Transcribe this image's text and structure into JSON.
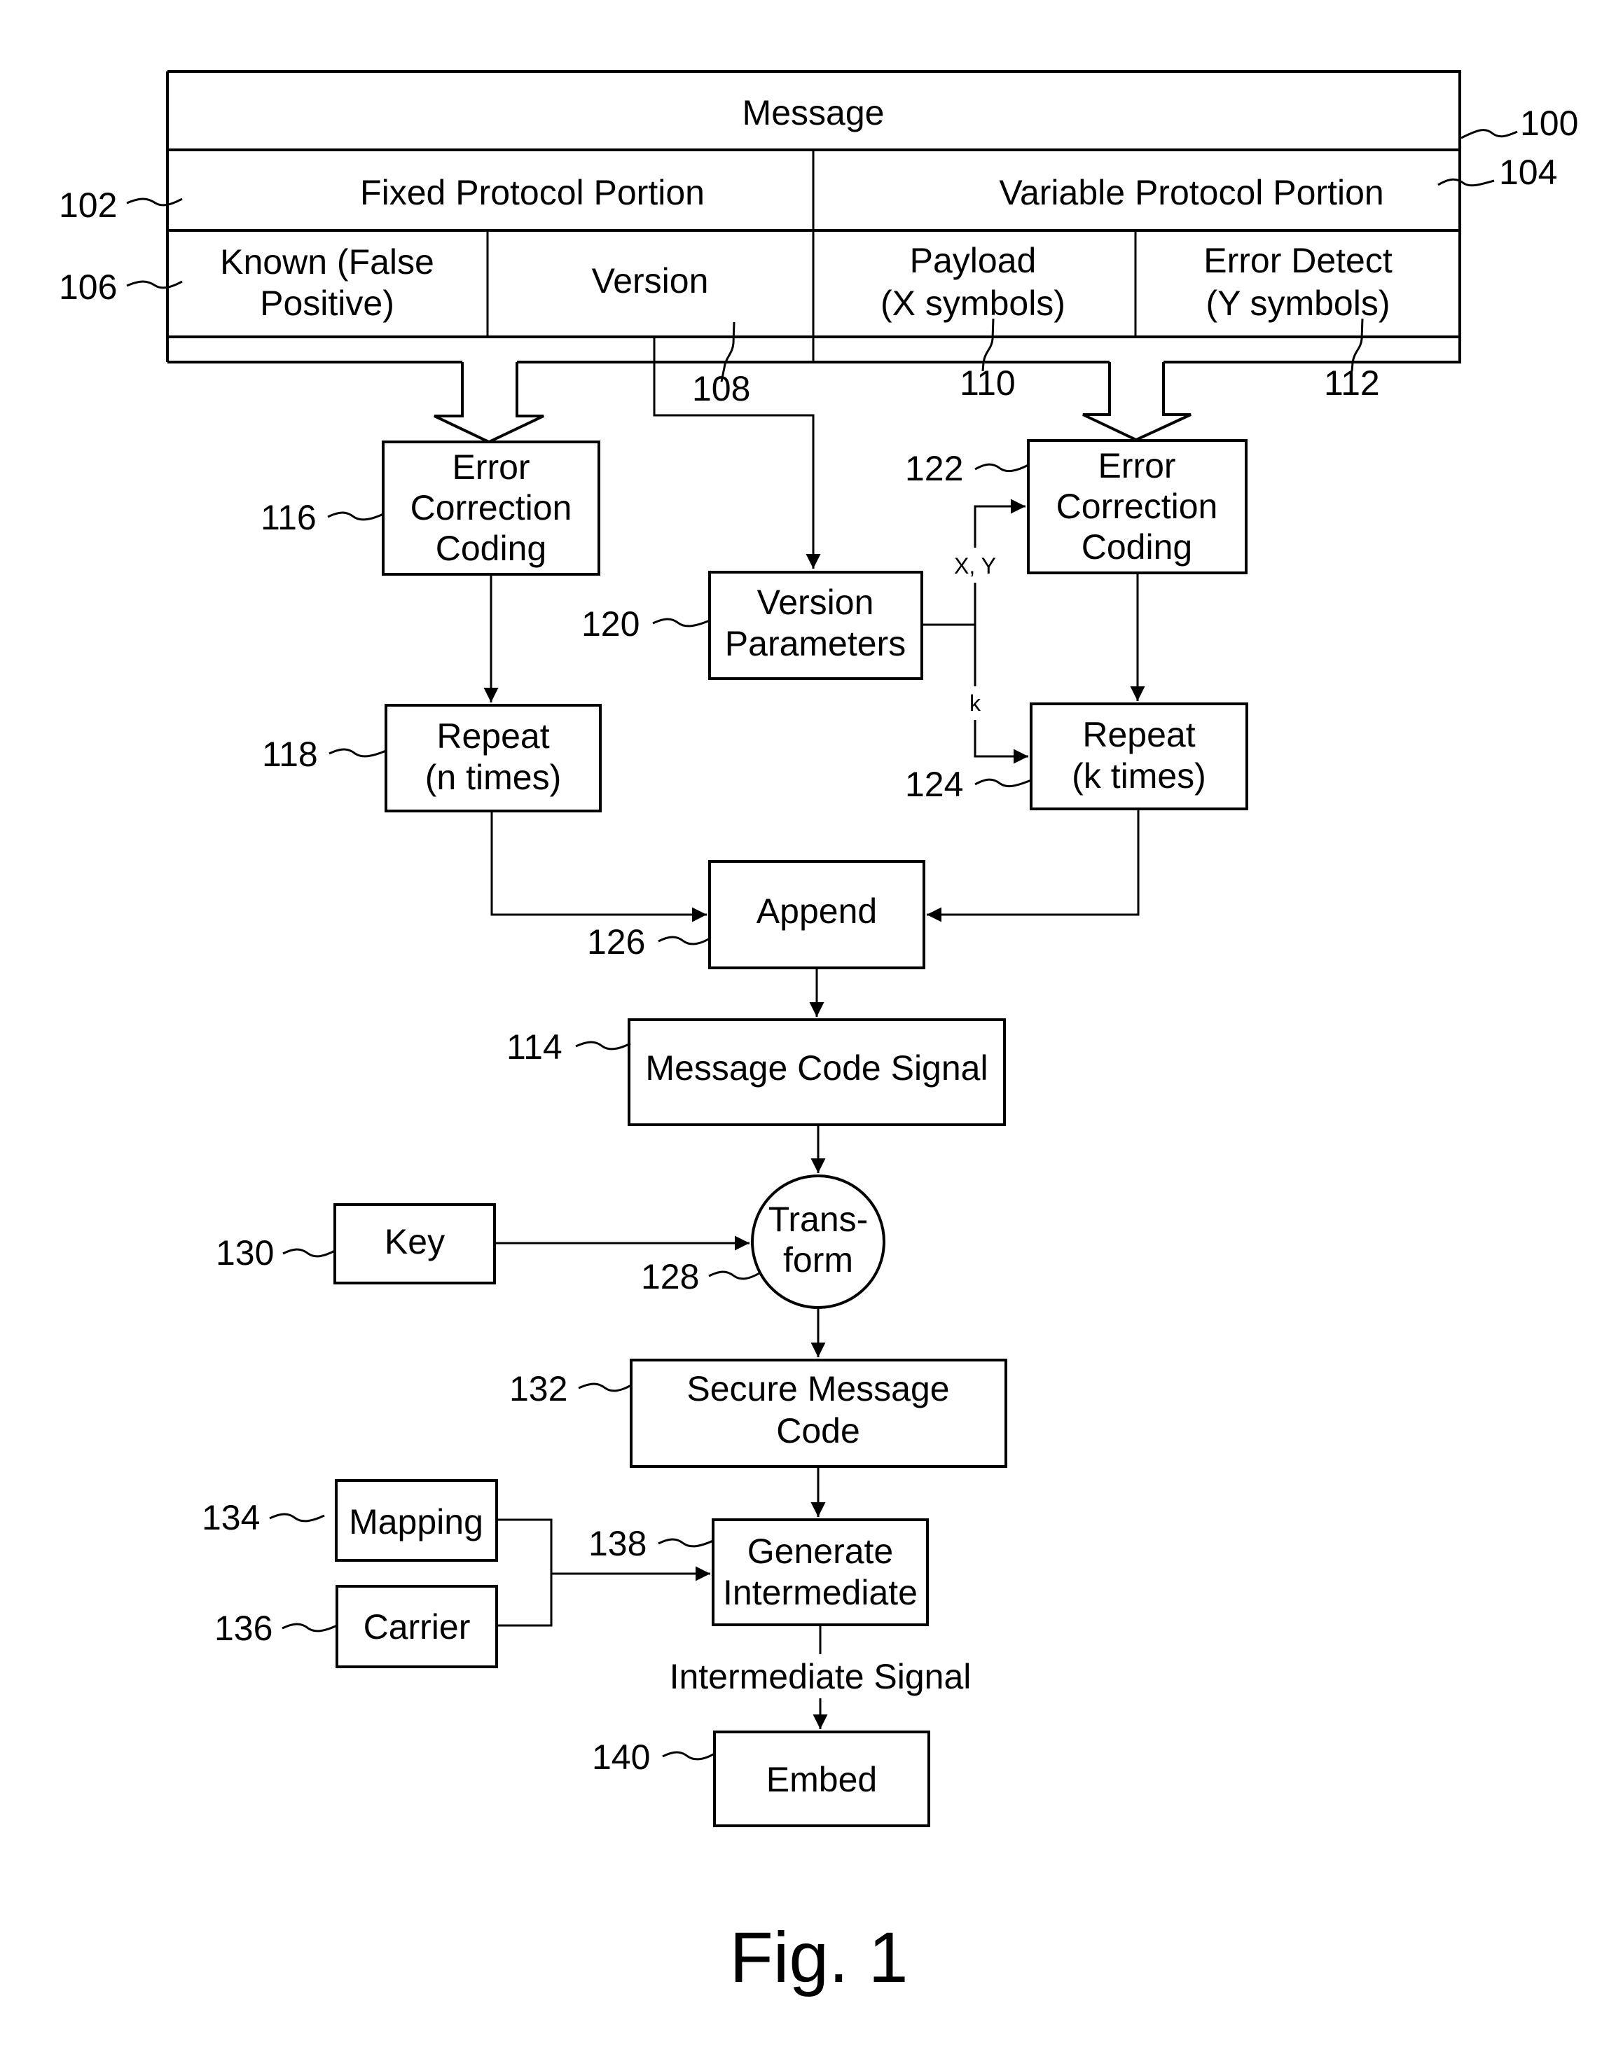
{
  "figure": {
    "caption": "Fig. 1",
    "message_structure": {
      "ref": "100",
      "title": "Message",
      "fixed_portion": {
        "ref": "102",
        "label": "Fixed Protocol Portion"
      },
      "variable_portion": {
        "ref": "104",
        "label": "Variable Protocol Portion"
      },
      "fields": [
        {
          "ref": "106",
          "lines": [
            "Known (False",
            "Positive)"
          ]
        },
        {
          "ref": "108",
          "lines": [
            "Version"
          ]
        },
        {
          "ref": "110",
          "lines": [
            "Payload",
            "(X symbols)"
          ]
        },
        {
          "ref": "112",
          "lines": [
            "Error Detect",
            "(Y symbols)"
          ]
        }
      ]
    },
    "blocks": {
      "ecc_fixed": {
        "ref": "116",
        "lines": [
          "Error",
          "Correction",
          "Coding"
        ]
      },
      "repeat_n": {
        "ref": "118",
        "lines": [
          "Repeat",
          "(n times)"
        ]
      },
      "version_params": {
        "ref": "120",
        "lines": [
          "Version",
          "Parameters"
        ]
      },
      "ecc_variable": {
        "ref": "122",
        "lines": [
          "Error",
          "Correction",
          "Coding"
        ]
      },
      "repeat_k": {
        "ref": "124",
        "lines": [
          "Repeat",
          "(k times)"
        ]
      },
      "append": {
        "ref": "126",
        "lines": [
          "Append"
        ]
      },
      "message_code_signal": {
        "ref": "114",
        "lines": [
          "Message Code Signal"
        ]
      },
      "transform": {
        "ref": "128",
        "lines": [
          "Trans-",
          "form"
        ]
      },
      "key": {
        "ref": "130",
        "lines": [
          "Key"
        ]
      },
      "secure_message_code": {
        "ref": "132",
        "lines": [
          "Secure Message",
          "Code"
        ]
      },
      "mapping": {
        "ref": "134",
        "lines": [
          "Mapping"
        ]
      },
      "carrier": {
        "ref": "136",
        "lines": [
          "Carrier"
        ]
      },
      "generate_intermediate": {
        "ref": "138",
        "lines": [
          "Generate",
          "Intermediate"
        ]
      },
      "embed": {
        "ref": "140",
        "lines": [
          "Embed"
        ]
      }
    },
    "edge_labels": {
      "xy": "X, Y",
      "k": "k",
      "intermediate_signal": "Intermediate Signal"
    }
  }
}
